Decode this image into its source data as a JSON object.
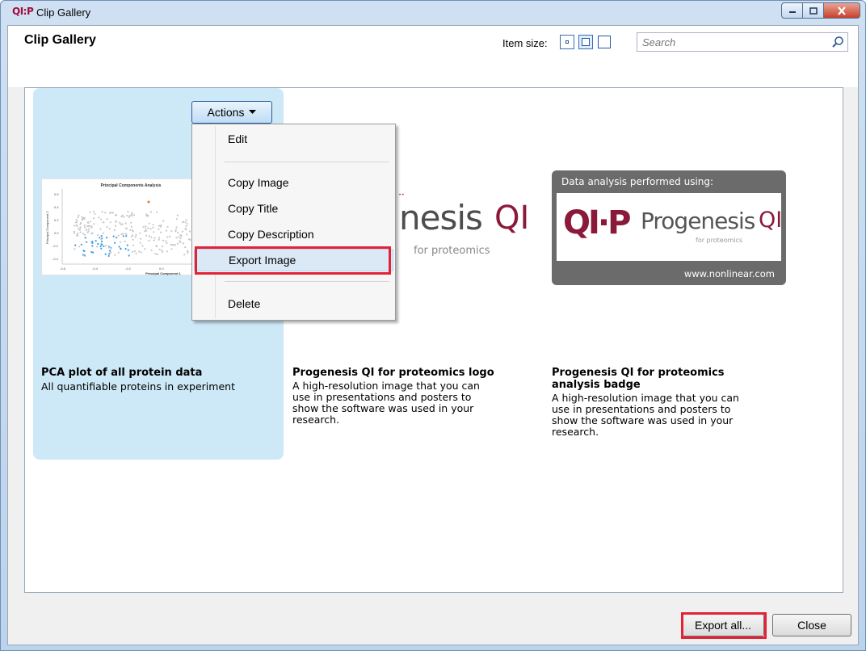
{
  "window": {
    "title": "Clip Gallery",
    "logo_text": "QI:P",
    "controls": {
      "minimize_icon": "minimize-icon",
      "maximize_icon": "maximize-icon",
      "close_icon": "close-icon"
    }
  },
  "header": {
    "title": "Clip Gallery",
    "item_size_label": "Item size:",
    "size_options": [
      "small",
      "medium",
      "large"
    ],
    "selected_size": "medium",
    "search_placeholder": "Search"
  },
  "actions_menu": {
    "button_label": "Actions",
    "items": [
      "Edit",
      "Copy Image",
      "Copy Title",
      "Copy Description",
      "Export Image",
      "Delete"
    ],
    "highlighted": "Export Image"
  },
  "clips": [
    {
      "title": "PCA plot of all protein data",
      "description": "All quantifiable proteins in experiment",
      "thumb": {
        "title": "Principal Components Analysis",
        "xlabel": "Principal Component 1",
        "ylabel": "Principal Component 2",
        "x_ticks": [
          "-0.6",
          "-0.4",
          "-0.2",
          "0.0"
        ],
        "y_ticks": [
          "0.6",
          "0.4",
          "0.2",
          "0.0",
          "-0.2",
          "-0.4"
        ]
      }
    },
    {
      "title": "Progenesis QI for proteomics logo",
      "description_lines": [
        "A high-resolution image that you can",
        "use in presentations and posters to",
        "show the software was used in your",
        "research."
      ],
      "logo_word": "nesis",
      "logo_suffix": "QI",
      "logo_sub": "for proteomics"
    },
    {
      "title_lines": [
        "Progenesis QI for proteomics",
        "analysis badge"
      ],
      "description_lines": [
        "A high-resolution image that you can",
        "use in presentations and posters to",
        "show the software was used in your",
        "research."
      ],
      "badge_top": "Data analysis performed using:",
      "badge_mark": "QI·P",
      "badge_word": "Progenesis",
      "badge_suffix": "QI",
      "badge_sub": "for proteomics",
      "badge_url": "www.nonlinear.com"
    }
  ],
  "footer": {
    "export_all_label": "Export all...",
    "close_label": "Close"
  },
  "colors": {
    "highlight_red": "#e32334",
    "selected_bg": "#cde8f6",
    "brand": "#8b1a3a"
  }
}
